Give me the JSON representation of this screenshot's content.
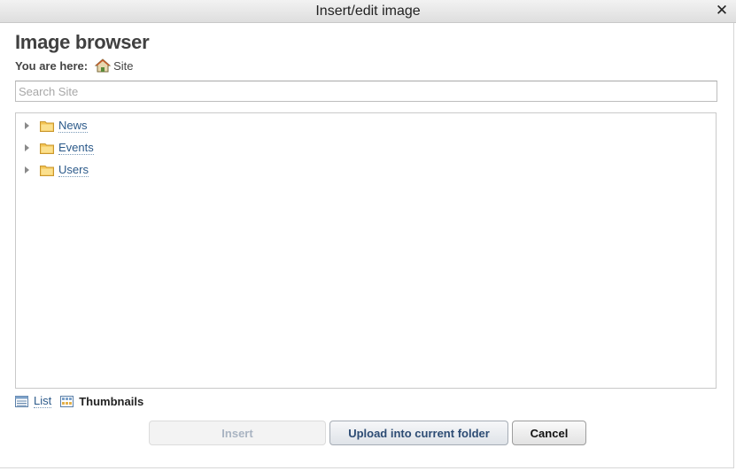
{
  "window": {
    "title": "Insert/edit image",
    "close_glyph": "✕"
  },
  "browser": {
    "heading": "Image browser",
    "breadcrumb": {
      "label": "You are here:",
      "home_icon": "home-icon",
      "current": "Site"
    },
    "search": {
      "placeholder": "Search Site",
      "value": ""
    },
    "tree": {
      "items": [
        {
          "label": "News",
          "icon": "folder-icon"
        },
        {
          "label": "Events",
          "icon": "folder-icon"
        },
        {
          "label": "Users",
          "icon": "folder-icon"
        }
      ]
    },
    "view_modes": {
      "list_label": "List",
      "thumbnails_label": "Thumbnails",
      "active": "Thumbnails"
    }
  },
  "buttons": {
    "insert_label": "Insert",
    "insert_enabled": false,
    "upload_label": "Upload into current folder",
    "cancel_label": "Cancel"
  },
  "colors": {
    "link": "#2c5a8a",
    "folder": "#f3c454",
    "disabled_text": "#a9b4c2"
  }
}
